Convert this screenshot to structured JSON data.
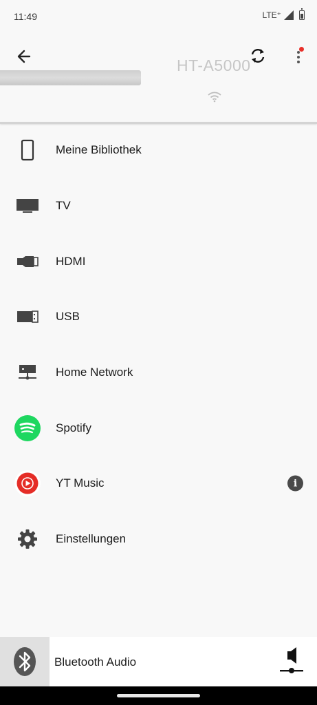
{
  "status": {
    "time": "11:49",
    "network": "LTE⁺"
  },
  "header": {
    "device_name": "HT-A5000"
  },
  "sources": [
    {
      "label": "Meine Bibliothek",
      "icon": "phone-icon"
    },
    {
      "label": "TV",
      "icon": "tv-icon"
    },
    {
      "label": "HDMI",
      "icon": "hdmi-icon"
    },
    {
      "label": "USB",
      "icon": "usb-icon"
    },
    {
      "label": "Home Network",
      "icon": "home-network-icon"
    },
    {
      "label": "Spotify",
      "icon": "spotify-icon"
    },
    {
      "label": "YT Music",
      "icon": "yt-music-icon"
    },
    {
      "label": "Einstellungen",
      "icon": "gear-icon"
    }
  ],
  "bottom_bar": {
    "label": "Bluetooth Audio"
  },
  "colors": {
    "spotify": "#1ed760",
    "yt_music": "#e52d27",
    "notification": "#e8302a",
    "icon_dark": "#444444"
  }
}
